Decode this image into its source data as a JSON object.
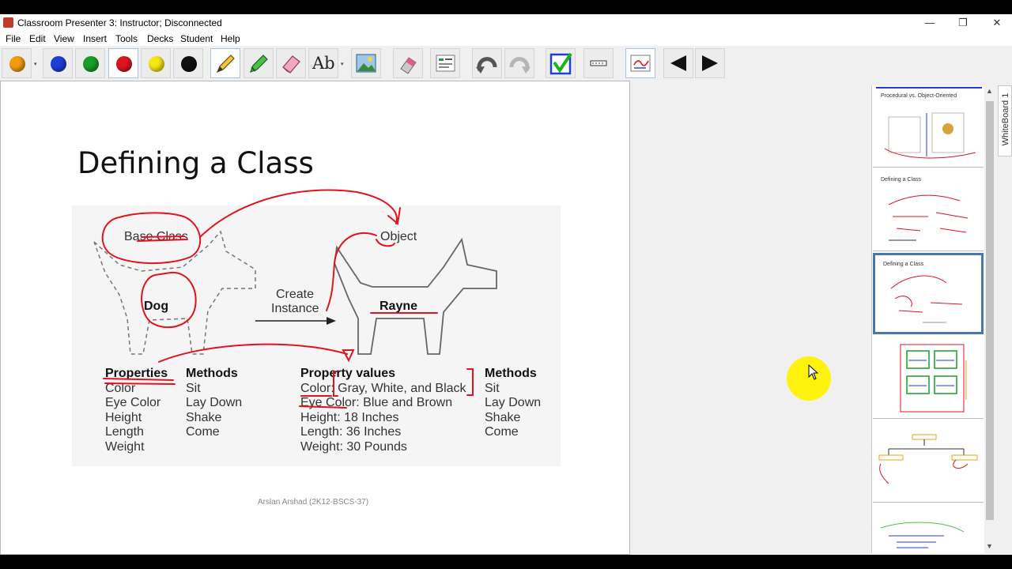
{
  "window": {
    "title": "Classroom Presenter 3: Instructor; Disconnected",
    "minimize": "—",
    "maximize": "❐",
    "close": "✕"
  },
  "menu": [
    "File",
    "Edit",
    "View",
    "Insert",
    "Tools",
    "Decks",
    "Student",
    "Help"
  ],
  "toolbar": {
    "pens": [
      {
        "name": "orange",
        "color": "#f39c12"
      },
      {
        "name": "blue",
        "color": "#1e3fd6"
      },
      {
        "name": "green",
        "color": "#1a9e2a"
      },
      {
        "name": "red",
        "color": "#e0141e"
      },
      {
        "name": "yellow",
        "color": "#f5e616"
      },
      {
        "name": "black",
        "color": "#111111"
      }
    ],
    "text_tool_label": "Ab",
    "dropdown_glyph": "▾"
  },
  "slide": {
    "title": "Defining a Class",
    "base_class_label": "Base Class",
    "object_label": "Object",
    "create_instance_line1": "Create",
    "create_instance_line2": "Instance",
    "dog_label": "Dog",
    "rayne_label": "Rayne",
    "properties_header": "Properties",
    "properties": [
      "Color",
      "Eye Color",
      "Height",
      "Length",
      "Weight"
    ],
    "methods_header_left": "Methods",
    "methods_left": [
      "Sit",
      "Lay Down",
      "Shake",
      "Come"
    ],
    "property_values_header": "Property values",
    "property_values": [
      "Color: Gray, White, and Black",
      "Eye Color: Blue and Brown",
      "Height: 18 Inches",
      "Length: 36 Inches",
      "Weight: 30 Pounds"
    ],
    "methods_header_right": "Methods",
    "methods_right": [
      "Sit",
      "Lay Down",
      "Shake",
      "Come"
    ],
    "footer": "Arslan Arshad (2K12-BSCS-37)",
    "ink_color": "#e0141e"
  },
  "thumbnails": [
    {
      "title": "Procedural vs. Object-Oriented"
    },
    {
      "title": "Defining a Class"
    },
    {
      "title": "Defining a Class"
    },
    {
      "title": ""
    },
    {
      "title": ""
    },
    {
      "title": ""
    }
  ],
  "side_tab": "WhiteBoard 1",
  "highlight_color": "#fff200"
}
